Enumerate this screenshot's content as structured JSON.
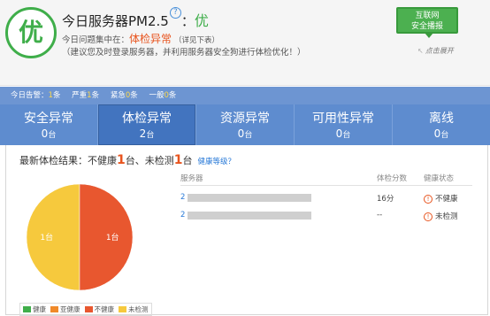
{
  "header": {
    "grade_char": "优",
    "title": "今日服务器PM2.5",
    "help": "?",
    "colon": "：",
    "grade": "优",
    "issue_prefix": "今日问题集中在：",
    "issue_focus": "体检异常",
    "issue_detail": "（详见下表）",
    "advice": "（建议您及时登录服务器，并利用服务器安全狗进行体检优化！）",
    "hlw_line1": "互联网",
    "hlw_line2": "安全播报",
    "expand_arrow": "↖",
    "expand_text": "点击展开"
  },
  "alerts": [
    {
      "label": "今日告警：",
      "count": "1",
      "unit": "条"
    },
    {
      "label": "严重",
      "count": "1",
      "unit": "条"
    },
    {
      "label": "紧急",
      "count": "0",
      "unit": "条"
    },
    {
      "label": "一般",
      "count": "0",
      "unit": "条"
    }
  ],
  "tabs": [
    {
      "label": "安全异常",
      "count": "0",
      "unit": "台"
    },
    {
      "label": "体检异常",
      "count": "2",
      "unit": "台"
    },
    {
      "label": "资源异常",
      "count": "0",
      "unit": "台"
    },
    {
      "label": "可用性异常",
      "count": "0",
      "unit": "台"
    },
    {
      "label": "离线",
      "count": "0",
      "unit": "台"
    }
  ],
  "result": {
    "prefix": "最新体检结果：不健康",
    "unhealthy_count": "1",
    "mid": "台、未检测",
    "unchecked_count": "1",
    "suffix": "台",
    "level_link": "健康等级？"
  },
  "table": {
    "headers": [
      "服务器",
      "体检分数",
      "健康状态"
    ],
    "rows": [
      {
        "server": "2",
        "score": "16分",
        "status": "不健康"
      },
      {
        "server": "2",
        "score": "--",
        "status": "未检测"
      }
    ]
  },
  "chart_data": {
    "type": "pie",
    "slices": [
      {
        "label": "未检测",
        "value": 1,
        "display": "1台",
        "color": "#f6c93d"
      },
      {
        "label": "不健康",
        "value": 1,
        "display": "1台",
        "color": "#e8572f"
      }
    ]
  },
  "legend": [
    {
      "label": "健康",
      "color": "#3fae4a"
    },
    {
      "label": "亚健康",
      "color": "#f08a2a"
    },
    {
      "label": "不健康",
      "color": "#e8572f"
    },
    {
      "label": "未检测",
      "color": "#f6c93d"
    }
  ]
}
